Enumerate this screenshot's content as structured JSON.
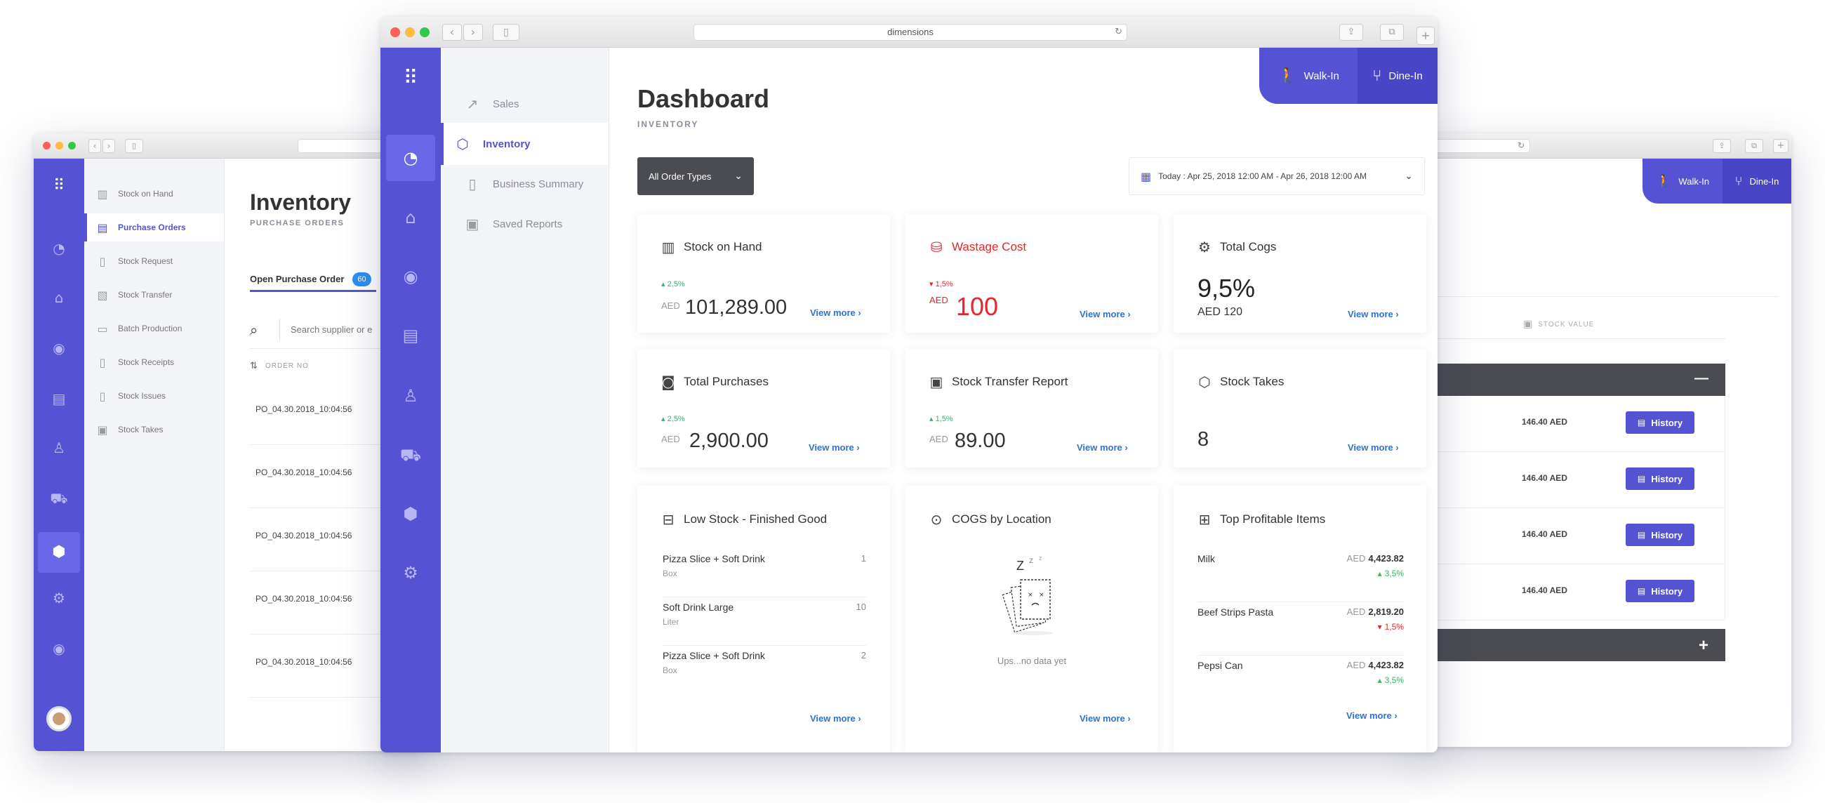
{
  "left_window": {
    "page_title": "Inventory",
    "page_subtitle": "PURCHASE ORDERS",
    "nav": [
      {
        "label": "Stock on Hand",
        "icon": "building-icon"
      },
      {
        "label": "Purchase Orders",
        "icon": "order-list-icon",
        "active": true
      },
      {
        "label": "Stock Request",
        "icon": "clipboard-icon"
      },
      {
        "label": "Stock Transfer",
        "icon": "transfer-icon"
      },
      {
        "label": "Batch Production",
        "icon": "batch-icon"
      },
      {
        "label": "Stock Receipts",
        "icon": "receipt-icon"
      },
      {
        "label": "Stock Issues",
        "icon": "issue-icon"
      },
      {
        "label": "Stock Takes",
        "icon": "box-icon"
      }
    ],
    "tab_label": "Open Purchase Order",
    "tab_count": "60",
    "search_placeholder": "Search supplier or e",
    "column_header": "ORDER NO",
    "orders": [
      "PO_04.30.2018_10:04:56",
      "PO_04.30.2018_10:04:56",
      "PO_04.30.2018_10:04:56",
      "PO_04.30.2018_10:04:56",
      "PO_04.30.2018_10:04:56"
    ]
  },
  "right_window": {
    "walkin_label": "Walk-In",
    "dinein_label": "Dine-In",
    "column_header": "STOCK VALUE",
    "rows": [
      {
        "value": "146.40 AED",
        "button": "History"
      },
      {
        "value": "146.40 AED",
        "button": "History"
      },
      {
        "value": "146.40 AED",
        "button": "History"
      },
      {
        "value": "146.40 AED",
        "button": "History"
      }
    ],
    "collapse_symbol": "—",
    "expand_symbol": "+"
  },
  "main_window": {
    "url": "dimensions",
    "subnav": [
      {
        "label": "Sales",
        "icon": "trend-icon"
      },
      {
        "label": "Inventory",
        "icon": "cube-icon",
        "active": true
      },
      {
        "label": "Business Summary",
        "icon": "clipboard-icon"
      },
      {
        "label": "Saved Reports",
        "icon": "report-icon"
      }
    ],
    "page_title": "Dashboard",
    "page_subtitle": "INVENTORY",
    "walkin_label": "Walk-In",
    "dinein_label": "Dine-In",
    "order_type_select": "All Order Types",
    "date_range": "Today : Apr 25, 2018 12:00 AM - Apr 26, 2018 12:00 AM",
    "view_more": "View more",
    "cards": {
      "stock_on_hand": {
        "title": "Stock on Hand",
        "delta": "2,5%",
        "currency": "AED",
        "value": "101,289.00"
      },
      "wastage_cost": {
        "title": "Wastage Cost",
        "delta": "1,5%",
        "currency": "AED",
        "value": "100"
      },
      "total_cogs": {
        "title": "Total Cogs",
        "value": "9,5%",
        "sub": "AED 120"
      },
      "total_purchases": {
        "title": "Total Purchases",
        "delta": "2,5%",
        "currency": "AED",
        "value": "2,900.00"
      },
      "stock_transfer": {
        "title": "Stock Transfer Report",
        "delta": "1,5%",
        "currency": "AED",
        "value": "89.00"
      },
      "stock_takes": {
        "title": "Stock Takes",
        "value": "8"
      },
      "low_stock": {
        "title": "Low Stock - Finished Good",
        "items": [
          {
            "name": "Pizza Slice + Soft Drink",
            "unit": "Box",
            "qty": "1"
          },
          {
            "name": "Soft Drink Large",
            "unit": "Liter",
            "qty": "10"
          },
          {
            "name": "Pizza Slice + Soft Drink",
            "unit": "Box",
            "qty": "2"
          }
        ]
      },
      "cogs_location": {
        "title": "COGS by Location",
        "empty_text": "Ups...no data yet"
      },
      "top_profitable": {
        "title": "Top Profitable Items",
        "items": [
          {
            "name": "Milk",
            "currency": "AED",
            "amount": "4,423.82",
            "delta": "3,5%",
            "trend": "up"
          },
          {
            "name": "Beef Strips Pasta",
            "currency": "AED",
            "amount": "2,819.20",
            "delta": "1,5%",
            "trend": "down"
          },
          {
            "name": "Pepsi Can",
            "currency": "AED",
            "amount": "4,423.82",
            "delta": "3,5%",
            "trend": "up"
          }
        ]
      }
    }
  },
  "colors": {
    "accent": "#5553d4",
    "link": "#2b74d6",
    "positive": "#3bb36a",
    "negative": "#e5262b",
    "dark_bar": "#4a4c52"
  }
}
